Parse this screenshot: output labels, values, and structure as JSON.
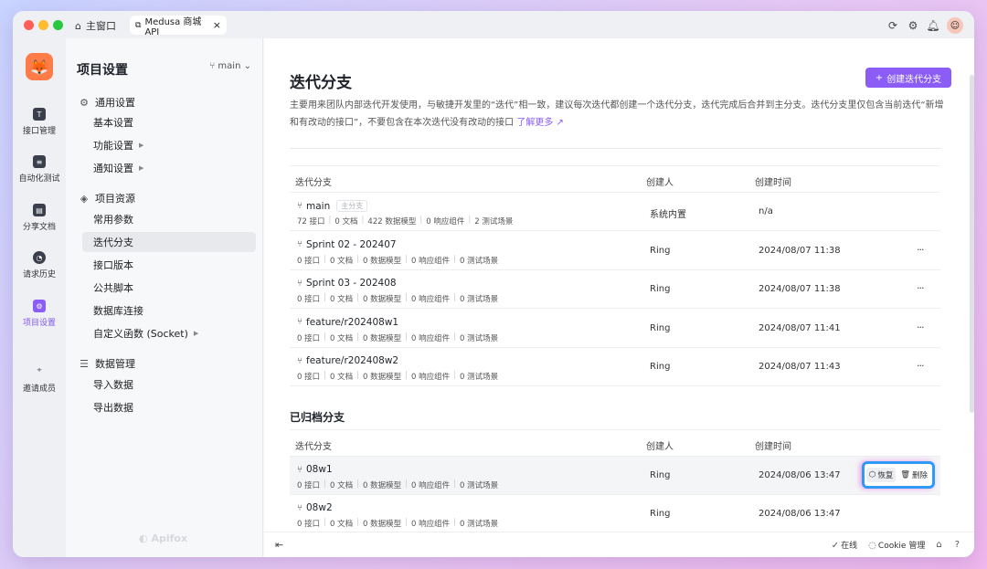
{
  "titlebar": {
    "home_tab": "主窗口",
    "api_tab": "Medusa 商城 API",
    "close_tab": "×"
  },
  "rail": {
    "items": [
      {
        "label": "接口管理",
        "icon": "api-icon"
      },
      {
        "label": "自动化测试",
        "icon": "automation-icon"
      },
      {
        "label": "分享文档",
        "icon": "share-doc-icon"
      },
      {
        "label": "请求历史",
        "icon": "history-icon"
      },
      {
        "label": "项目设置",
        "icon": "project-settings-icon"
      },
      {
        "label": "邀请成员",
        "icon": "invite-member-icon"
      }
    ]
  },
  "sidebar": {
    "title": "项目设置",
    "branch": "main",
    "groups": [
      {
        "label": "通用设置",
        "items": [
          "基本设置",
          "功能设置",
          "通知设置"
        ]
      },
      {
        "label": "项目资源",
        "items": [
          "常用参数",
          "迭代分支",
          "接口版本",
          "公共脚本",
          "数据库连接",
          "自定义函数 (Socket)"
        ]
      },
      {
        "label": "数据管理",
        "items": [
          "导入数据",
          "导出数据"
        ]
      }
    ],
    "brand": "Apifox"
  },
  "main": {
    "title": "迭代分支",
    "create_button": "创建迭代分支",
    "description": "主要用来团队内部迭代开发使用，与敏捷开发里的“迭代”相一致，建议每次迭代都创建一个迭代分支，迭代完成后合并到主分支。迭代分支里仅包含当前迭代“新增和有改动的接口”，不要包含在本次迭代没有改动的接口",
    "learn_more": "了解更多 ↗",
    "columns": [
      "迭代分支",
      "创建人",
      "创建时间"
    ],
    "branches": [
      {
        "name": "main",
        "tag": "主分支",
        "stats": [
          "72 接口",
          "0 文档",
          "422 数据模型",
          "0 响应组件",
          "2 测试场景"
        ],
        "creator": "系统内置",
        "time": "n/a",
        "more": ""
      },
      {
        "name": "Sprint 02 - 202407",
        "tag": "",
        "stats": [
          "0 接口",
          "0 文档",
          "0 数据模型",
          "0 响应组件",
          "0 测试场景"
        ],
        "creator": "Ring",
        "time": "2024/08/07 11:38",
        "more": "···"
      },
      {
        "name": "Sprint 03 - 202408",
        "tag": "",
        "stats": [
          "0 接口",
          "0 文档",
          "0 数据模型",
          "0 响应组件",
          "0 测试场景"
        ],
        "creator": "Ring",
        "time": "2024/08/07 11:38",
        "more": "···"
      },
      {
        "name": "feature/r202408w1",
        "tag": "",
        "stats": [
          "0 接口",
          "0 文档",
          "0 数据模型",
          "0 响应组件",
          "0 测试场景"
        ],
        "creator": "Ring",
        "time": "2024/08/07 11:41",
        "more": "···"
      },
      {
        "name": "feature/r202408w2",
        "tag": "",
        "stats": [
          "0 接口",
          "0 文档",
          "0 数据模型",
          "0 响应组件",
          "0 测试场景"
        ],
        "creator": "Ring",
        "time": "2024/08/07 11:43",
        "more": "···"
      }
    ],
    "archived_title": "已归档分支",
    "archived": [
      {
        "name": "08w1",
        "stats": [
          "0 接口",
          "0 文档",
          "0 数据模型",
          "0 响应组件",
          "0 测试场景"
        ],
        "creator": "Ring",
        "time": "2024/08/06 13:47",
        "restore": "恢复",
        "delete": "删除"
      },
      {
        "name": "08w2",
        "stats": [
          "0 接口",
          "0 文档",
          "0 数据模型",
          "0 响应组件",
          "0 测试场景"
        ],
        "creator": "Ring",
        "time": "2024/08/06 13:47"
      }
    ]
  },
  "bottombar": {
    "online": "在线",
    "cookie": "Cookie 管理"
  },
  "colors": {
    "accent": "#8b5cf6",
    "highlight_border": "#2f9bf5"
  }
}
